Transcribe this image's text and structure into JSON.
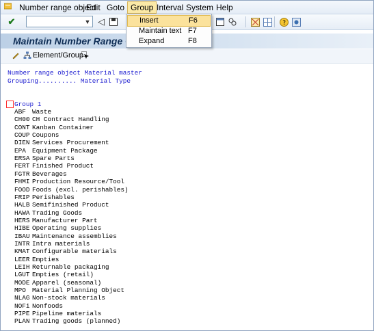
{
  "menu": {
    "items": [
      "Number range object",
      "Edit",
      "Goto",
      "Group",
      "Interval",
      "System",
      "Help"
    ],
    "active": "Group"
  },
  "group_menu": {
    "items": [
      {
        "label": "Insert",
        "shortcut": "F6"
      },
      {
        "label": "Maintain text",
        "shortcut": "F7"
      },
      {
        "label": "Expand",
        "shortcut": "F8"
      }
    ]
  },
  "page": {
    "title": "Maintain Number Range Gr"
  },
  "app_toolbar": {
    "element_group_label": "Element/Group"
  },
  "info": {
    "object_line": "Number range object Material master",
    "grouping_line": "Grouping.......... Material Type"
  },
  "group": {
    "label": "Group 1",
    "entries": [
      {
        "code": "ABF",
        "text": "Waste"
      },
      {
        "code": "CH00",
        "text": "CH Contract Handling"
      },
      {
        "code": "CONT",
        "text": "Kanban Container"
      },
      {
        "code": "COUP",
        "text": "Coupons"
      },
      {
        "code": "DIEN",
        "text": "Services Procurement"
      },
      {
        "code": "EPA",
        "text": "Equipment Package"
      },
      {
        "code": "ERSA",
        "text": "Spare Parts"
      },
      {
        "code": "FERT",
        "text": "Finished Product"
      },
      {
        "code": "FGTR",
        "text": "Beverages"
      },
      {
        "code": "FHMI",
        "text": "Production Resource/Tool"
      },
      {
        "code": "FOOD",
        "text": "Foods (excl. perishables)"
      },
      {
        "code": "FRIP",
        "text": "Perishables"
      },
      {
        "code": "HALB",
        "text": "Semifinished Product"
      },
      {
        "code": "HAWA",
        "text": "Trading Goods"
      },
      {
        "code": "HERS",
        "text": "Manufacturer Part"
      },
      {
        "code": "HIBE",
        "text": "Operating supplies"
      },
      {
        "code": "IBAU",
        "text": "Maintenance assemblies"
      },
      {
        "code": "INTR",
        "text": "Intra materials"
      },
      {
        "code": "KMAT",
        "text": "Configurable materials"
      },
      {
        "code": "LEER",
        "text": "Empties"
      },
      {
        "code": "LEIH",
        "text": "Returnable packaging"
      },
      {
        "code": "LGUT",
        "text": "Empties (retail)"
      },
      {
        "code": "MODE",
        "text": "Apparel (seasonal)"
      },
      {
        "code": "MPO",
        "text": "Material Planning Object"
      },
      {
        "code": "NLAG",
        "text": "Non-stock materials"
      },
      {
        "code": "NOFi",
        "text": "Nonfoods"
      },
      {
        "code": "PIPE",
        "text": "Pipeline materials"
      },
      {
        "code": "PLAN",
        "text": "Trading goods (planned)"
      }
    ]
  },
  "colors": {
    "title_text": "#0f2e56",
    "info_text": "#1b1bd0",
    "menu_highlight": "#fbe29c"
  }
}
